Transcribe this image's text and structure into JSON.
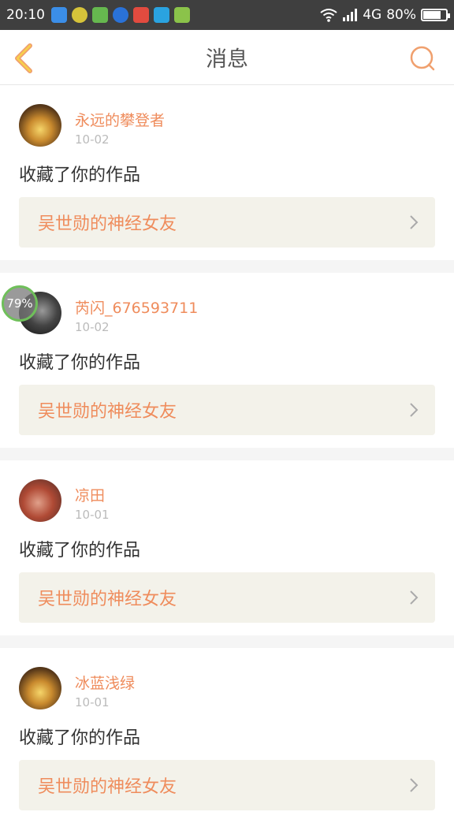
{
  "status": {
    "time": "20:10",
    "network": "4G",
    "battery": "80%",
    "battery_level": 0.8
  },
  "header": {
    "title": "消息",
    "back_icon": "chevron-left-icon",
    "search_icon": "search-icon",
    "accent": "#f0a06e"
  },
  "messages": [
    {
      "user": "永远的攀登者",
      "date": "10-02",
      "action": "收藏了你的作品",
      "work": "吴世勋的神经女友"
    },
    {
      "user": "芮闪_676593711",
      "date": "10-02",
      "action": "收藏了你的作品",
      "work": "吴世勋的神经女友"
    },
    {
      "user": "凉田",
      "date": "10-01",
      "action": "收藏了你的作品",
      "work": "吴世勋的神经女友"
    },
    {
      "user": "冰蓝浅绿",
      "date": "10-01",
      "action": "收藏了你的作品",
      "work": "吴世勋的神经女友"
    }
  ],
  "overlay": {
    "progress": "79%"
  },
  "colors": {
    "name": "#ef8c5c",
    "work_bg": "#f3f2ea",
    "statusbar": "#3f3f3f"
  }
}
